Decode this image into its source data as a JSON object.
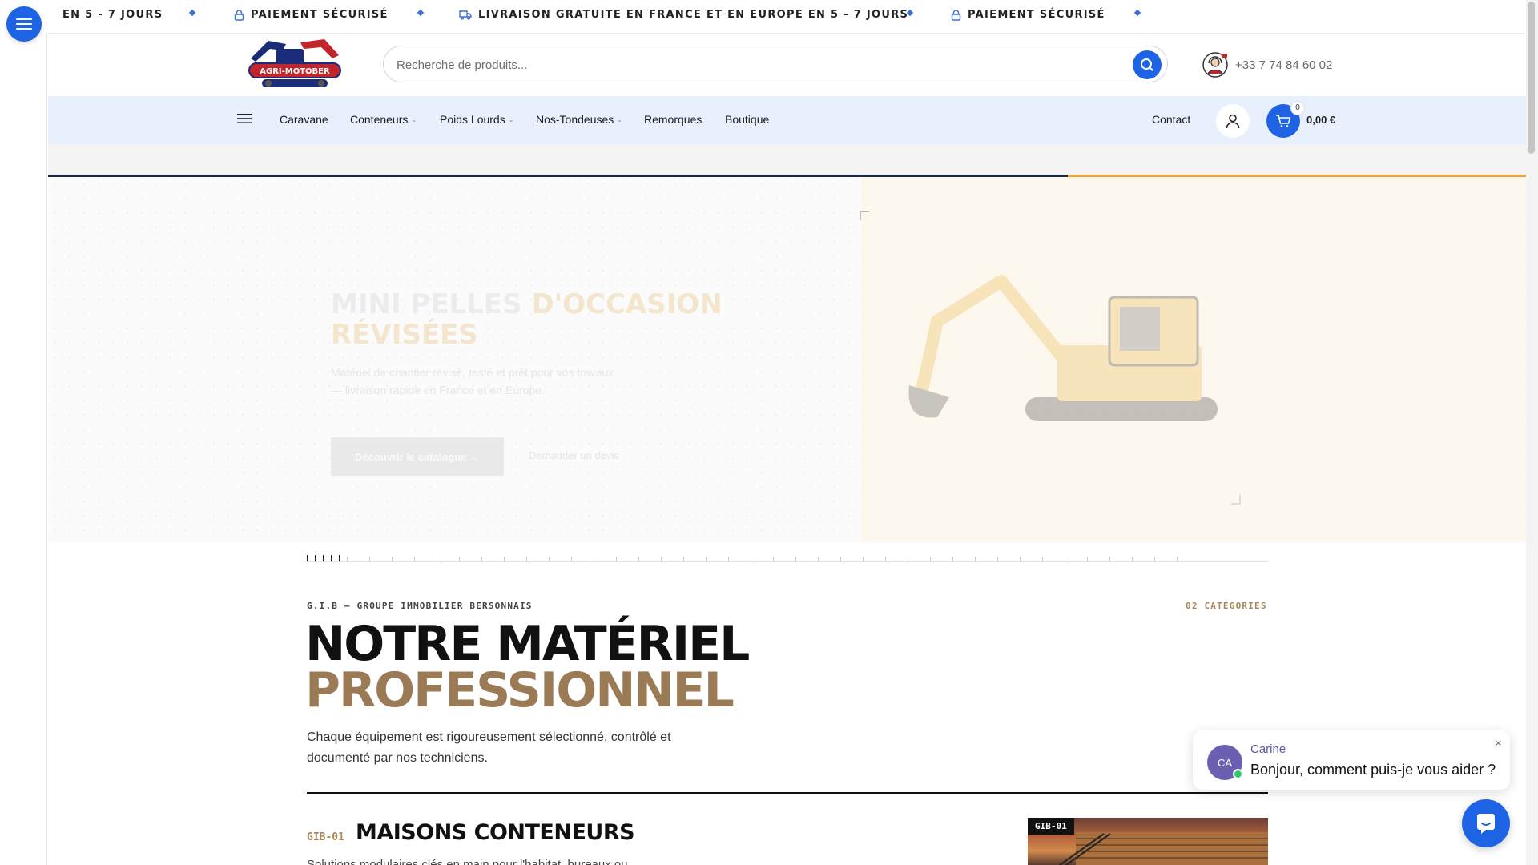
{
  "ticker": {
    "items": [
      {
        "text": "EN 5 - 7 JOURS",
        "icon": "none"
      },
      {
        "text": "PAIEMENT SÉCURISÉ",
        "icon": "lock-icon"
      },
      {
        "text": "LIVRAISON GRATUITE EN FRANCE ET EN EUROPE EN 5 - 7 JOURS",
        "icon": "truck-icon"
      },
      {
        "text": "PAIEMENT SÉCURISÉ",
        "icon": "lock-icon"
      }
    ]
  },
  "header": {
    "logo_text": "AGRI-MOTOBER",
    "search_placeholder": "Recherche de produits...",
    "phone": "+33 7 74 84 60 02"
  },
  "nav": {
    "items": [
      {
        "label": "Caravane",
        "has_dropdown": false
      },
      {
        "label": "Conteneurs",
        "has_dropdown": true
      },
      {
        "label": "Poids Lourds",
        "has_dropdown": true
      },
      {
        "label": "Nos-Tondeuses",
        "has_dropdown": true
      },
      {
        "label": "Remorques",
        "has_dropdown": false
      },
      {
        "label": "Boutique",
        "has_dropdown": false
      }
    ],
    "contact": "Contact",
    "cart_count": "0",
    "cart_total": "0,00 €"
  },
  "hero": {
    "eyebrow": "",
    "title_main": "MINI PELLES",
    "title_accent": "D'OCCASION",
    "title_line2": "RÉVISÉES",
    "description": "Matériel de chantier révisé, testé et prêt pour vos travaux — livraison rapide en France et en Europe.",
    "primary_button": "Découvrir le catalogue →",
    "secondary_button": "Demander un devis",
    "progress": 0.69
  },
  "section": {
    "eyebrow": "G.I.B — GROUPE IMMOBILIER BERSONNAIS",
    "count": "02 CATÉGORIES",
    "title_line1": "NOTRE MATÉRIEL",
    "title_line2": "PROFESSIONNEL",
    "description": "Chaque équipement est rigoureusement sélectionné, contrôlé et documenté par nos techniciens.",
    "item": {
      "code": "GIB-01",
      "title": "MAISONS CONTENEURS",
      "description": "Solutions modulaires clés en main pour l'habitat, bureaux ou",
      "image_tag": "GIB-01"
    }
  },
  "chat": {
    "avatar_initials": "CA",
    "agent_name": "Carine",
    "message": "Bonjour, comment puis-je vous aider ?",
    "close": "×"
  },
  "colors": {
    "primary": "#1d63e4",
    "nav_bg": "#e8f0fd",
    "accent_gold": "#9a7b55",
    "progress_dark": "#1a2a40",
    "progress_orange": "#f0a43a"
  }
}
